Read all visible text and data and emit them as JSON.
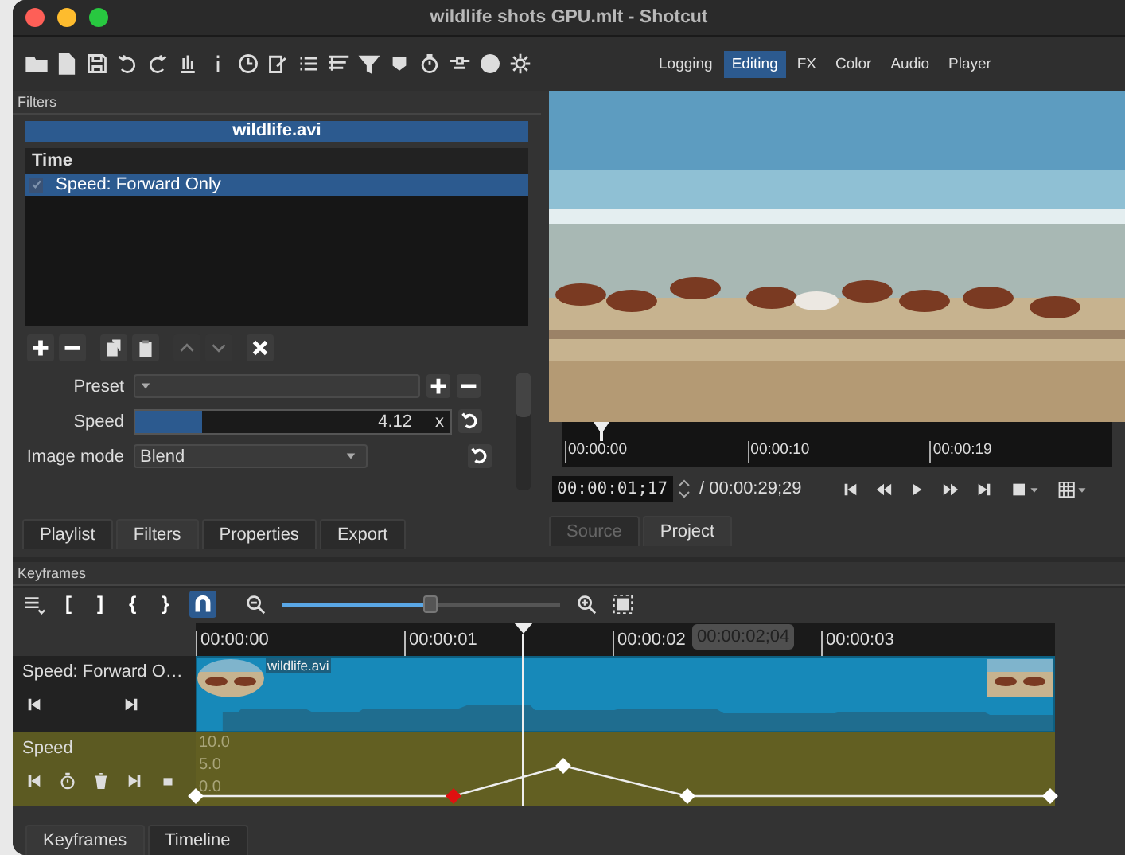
{
  "window": {
    "title": "wildlife shots GPU.mlt - Shotcut"
  },
  "layouts": [
    {
      "label": "Logging",
      "selected": false
    },
    {
      "label": "Editing",
      "selected": true
    },
    {
      "label": "FX",
      "selected": false
    },
    {
      "label": "Color",
      "selected": false
    },
    {
      "label": "Audio",
      "selected": false
    },
    {
      "label": "Player",
      "selected": false
    }
  ],
  "filters_panel": {
    "title": "Filters",
    "clip_name": "wildlife.avi",
    "list_header": "Time",
    "filters": [
      {
        "label": "Speed: Forward Only",
        "checked": true,
        "selected": true
      }
    ],
    "params": [
      {
        "kind": "preset",
        "label": "Preset"
      },
      {
        "kind": "slider",
        "label": "Speed",
        "value": "4.12",
        "unit": "x",
        "level": 0.21
      },
      {
        "kind": "dropdown",
        "label": "Image mode",
        "value": "Blend"
      }
    ],
    "tabs": [
      {
        "label": "Playlist",
        "selected": false
      },
      {
        "label": "Filters",
        "selected": true
      },
      {
        "label": "Properties",
        "selected": false
      },
      {
        "label": "Export",
        "selected": false
      }
    ]
  },
  "player": {
    "ruler": [
      "00:00:00",
      "00:00:10",
      "00:00:19"
    ],
    "timecode": "00:00:01;17",
    "duration": "/ 00:00:29;29",
    "tabs": [
      {
        "label": "Source",
        "selected": false,
        "disabled": true
      },
      {
        "label": "Project",
        "selected": true,
        "disabled": false
      }
    ]
  },
  "keyframes_panel": {
    "title": "Keyframes",
    "tools": [
      "[",
      "]",
      "{",
      "}"
    ],
    "snap_on": true,
    "zoom": {
      "level": 0.53
    },
    "ruler": [
      "00:00:00",
      "00:00:01",
      "00:00:02",
      "00:00:03"
    ],
    "tooltip": "00:00:02;04",
    "tracks": [
      {
        "kind": "clip",
        "name": "Speed: Forward O…",
        "clip_label": "wildlife.avi"
      },
      {
        "kind": "parameter",
        "name": "Speed",
        "scale": [
          "10.0",
          "5.0",
          "0.0"
        ],
        "keyframes": [
          {
            "selected": false
          },
          {
            "selected": true
          },
          {
            "selected": false
          },
          {
            "selected": false
          },
          {
            "selected": false
          }
        ]
      }
    ]
  },
  "bottom_tabs": [
    {
      "label": "Keyframes",
      "selected": true
    },
    {
      "label": "Timeline",
      "selected": false
    }
  ]
}
